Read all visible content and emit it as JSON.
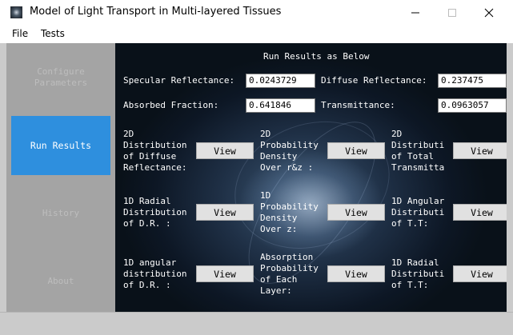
{
  "window": {
    "title": "Model of Light Transport in Multi-layered Tissues",
    "minimize": "—",
    "maximize": "☐",
    "close": "✕"
  },
  "menu": [
    "File",
    "Tests"
  ],
  "sidebar": {
    "items": [
      {
        "label": "Configure\nParameters",
        "active": false
      },
      {
        "label": "Run Results",
        "active": true
      },
      {
        "label": "History",
        "active": false
      },
      {
        "label": "About",
        "active": false
      }
    ],
    "active_color": "#2e8fde"
  },
  "results": {
    "heading": "Run Results as Below",
    "specular_label": "Specular Reflectance:",
    "specular_value": "0.0243729",
    "diffuse_label": "Diffuse Reflectance:",
    "diffuse_value": "0.237475",
    "absorbed_label": "Absorbed Fraction:",
    "absorbed_value": "0.641846",
    "transmittance_label": "Transmittance:",
    "transmittance_value": "0.0963057"
  },
  "plots": [
    {
      "label": "2D\nDistribution\nof Diffuse\nReflectance:",
      "button": "View"
    },
    {
      "label": "2D\nProbability\nDensity\nOver r&z :",
      "button": "View"
    },
    {
      "label": "2D\nDistributi\nof Total\nTransmitta",
      "button": "View"
    },
    {
      "label": "1D Radial\nDistribution\nof D.R. :",
      "button": "View"
    },
    {
      "label": "1D\nProbability\nDensity\nOver z:",
      "button": "View"
    },
    {
      "label": "1D Angular\nDistributi\nof T.T:",
      "button": "View"
    },
    {
      "label": "1D angular\ndistribution\nof D.R. :",
      "button": "View"
    },
    {
      "label": "Absorption\nProbability\nof Each\nLayer:",
      "button": "View"
    },
    {
      "label": "1D Radial\nDistributi\nof T.T:",
      "button": "View"
    }
  ]
}
